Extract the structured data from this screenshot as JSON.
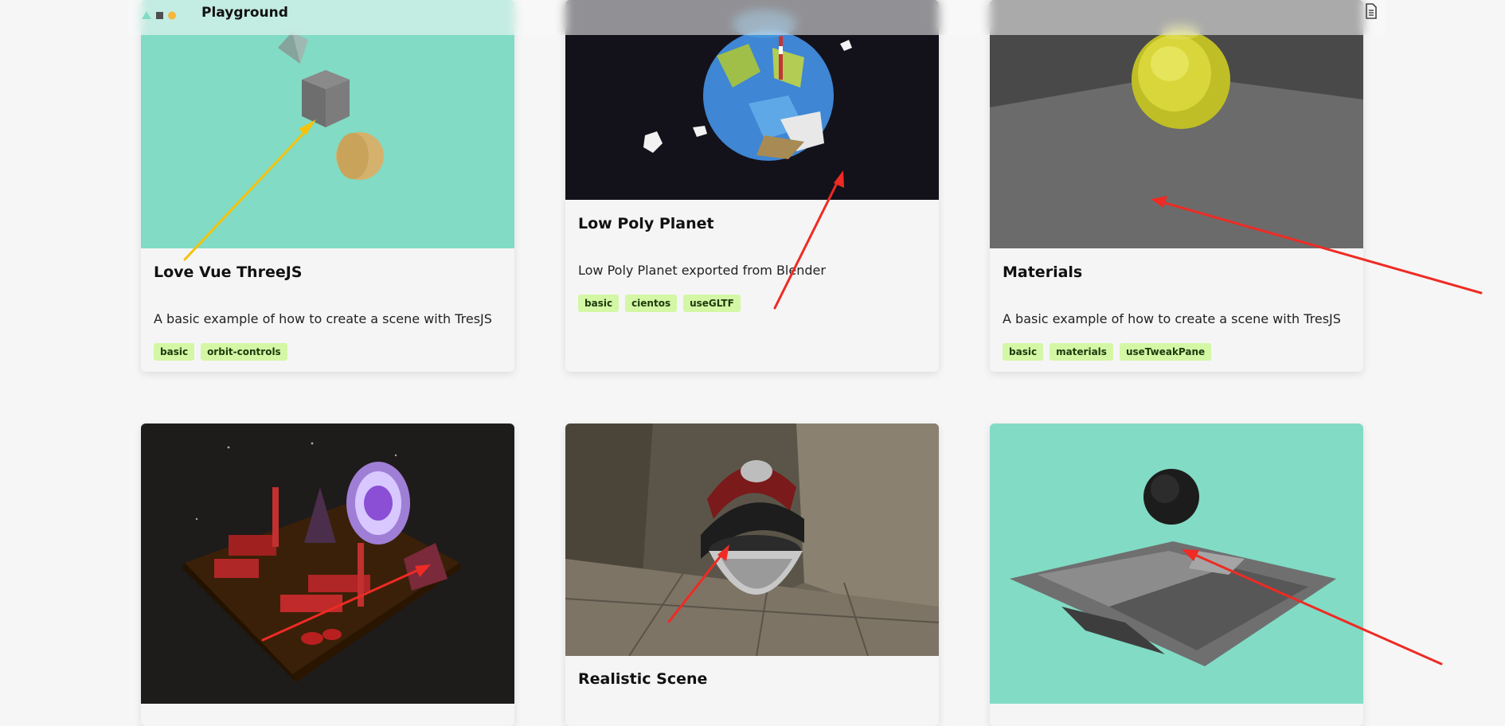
{
  "navbar": {
    "title": "Playground",
    "logo_icon": "tresjs-logo-icon",
    "doc_icon": "document-icon"
  },
  "colors": {
    "accent_green": "#82dbc5",
    "tag_bg": "#d3f7a5",
    "arrow_red": "#ee2b24",
    "arrow_yellow": "#f5c20b"
  },
  "cards": [
    {
      "title": "Love Vue ThreeJS",
      "description": "A basic example of how to create a scene with TresJS",
      "tags": [
        "basic",
        "orbit-controls"
      ]
    },
    {
      "title": "Low Poly Planet",
      "description": "Low Poly Planet exported from Blender",
      "tags": [
        "basic",
        "cientos",
        "useGLTF"
      ]
    },
    {
      "title": "Materials",
      "description": "A basic example of how to create a scene with TresJS",
      "tags": [
        "basic",
        "materials",
        "useTweakPane"
      ]
    },
    {
      "title": "",
      "description": "",
      "tags": []
    },
    {
      "title": "Realistic Scene",
      "description": "",
      "tags": []
    },
    {
      "title": "",
      "description": "",
      "tags": []
    }
  ]
}
